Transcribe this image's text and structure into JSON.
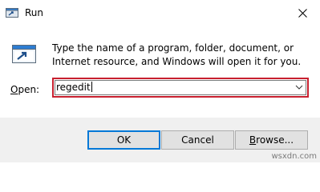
{
  "window": {
    "title": "Run"
  },
  "dialog": {
    "description": "Type the name of a program, folder, document, or Internet resource, and Windows will open it for you.",
    "open_label_accel": "O",
    "open_label_rest": "pen:",
    "open_value": "regedit"
  },
  "buttons": {
    "ok_label": "OK",
    "cancel_label": "Cancel",
    "browse_accel": "B",
    "browse_rest": "rowse..."
  },
  "watermark": "wsxdn.com",
  "colors": {
    "highlight_border": "#c8202f",
    "focus_border": "#0078d7",
    "footer_bg": "#f0f0f0"
  },
  "icons": {
    "title_icon": "run-icon",
    "dialog_icon": "run-icon",
    "close_icon": "close-icon",
    "dropdown_icon": "chevron-down-icon"
  }
}
